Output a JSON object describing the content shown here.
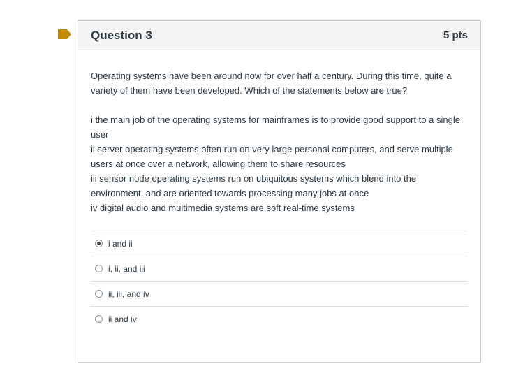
{
  "question": {
    "title": "Question 3",
    "points": "5 pts",
    "flag_color": "#c28b00",
    "paragraph": "Operating systems have been around now for over half a century. During this time, quite a variety of them have been developed. Which of the statements below are true?",
    "statements": [
      "i the main job of the operating systems for mainframes is to provide good support to a single user",
      "ii server operating systems often run on very large personal computers, and serve multiple users at once over a network, allowing them to share resources",
      "iii sensor node operating systems run on ubiquitous systems which blend into the environment, and are oriented towards processing many jobs at once",
      "iv digital audio and multimedia systems are soft real-time systems"
    ],
    "answers": [
      {
        "label": "i and ii",
        "selected": true
      },
      {
        "label": "i, ii, and iii",
        "selected": false
      },
      {
        "label": "ii, iii, and iv",
        "selected": false
      },
      {
        "label": "ii and iv",
        "selected": false
      }
    ]
  }
}
